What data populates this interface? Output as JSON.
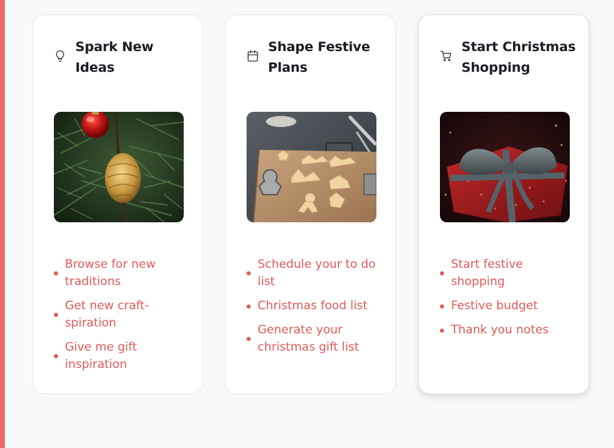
{
  "colors": {
    "accent": "#f06a6a",
    "link": "#e05a5a",
    "title": "#1a1d24",
    "background": "#f8f9fb"
  },
  "cards": [
    {
      "title": "Spark New Ideas",
      "icon": "lightbulb-icon",
      "image": "christmas-tree-ornament-image",
      "items": [
        "Browse for new traditions",
        "Get new craft-spiration",
        "Give me gift inspiration"
      ]
    },
    {
      "title": "Shape Festive Plans",
      "icon": "calendar-icon",
      "image": "gingerbread-cookies-image",
      "items": [
        "Schedule your to do list",
        "Christmas food list",
        "Generate your christmas gift list"
      ]
    },
    {
      "title": "Start Christmas Shopping",
      "icon": "shopping-cart-icon",
      "image": "wrapped-gift-image",
      "items": [
        "Start festive shopping",
        "Festive budget",
        "Thank you notes"
      ]
    }
  ]
}
